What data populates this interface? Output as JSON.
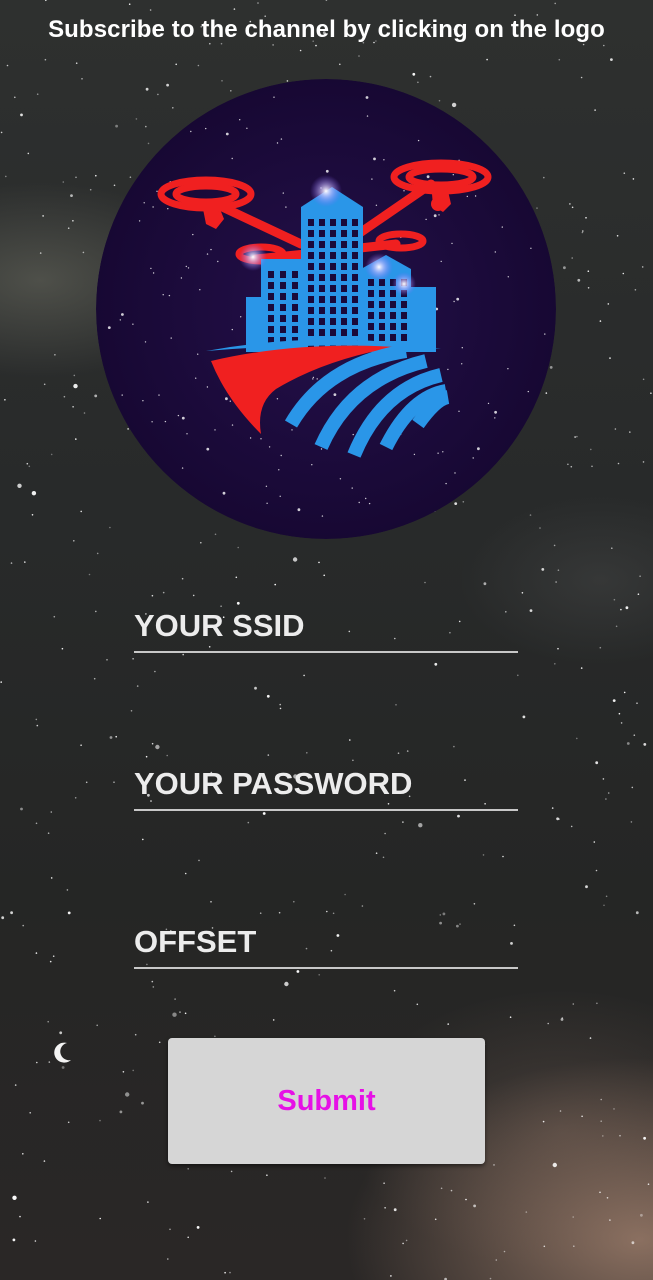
{
  "header": {
    "text": "Subscribe to the channel by clicking on the logo"
  },
  "logo": {
    "icon": "drone-city-logo-icon",
    "colors": {
      "circle_bg": "#1a0a3a",
      "drone_red": "#f02020",
      "building_blue": "#2a96e8"
    }
  },
  "form": {
    "ssid_placeholder": "YOUR SSID",
    "password_placeholder": "YOUR PASSWORD",
    "offset_placeholder": "OFFSET",
    "submit_label": "Submit"
  },
  "colors": {
    "submit_text": "#e610e6",
    "submit_bg": "#d6d6d6",
    "underline": "#c8c8c8"
  }
}
